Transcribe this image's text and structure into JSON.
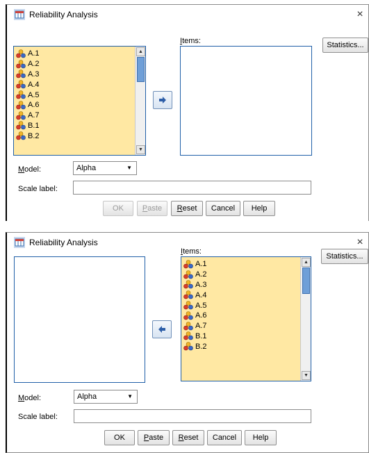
{
  "dialogs": [
    {
      "title": "Reliability Analysis",
      "close_glyph": "×",
      "items_label": "Items:",
      "statistics_label": "Statistics...",
      "model_label": "Model:",
      "model_value": "Alpha",
      "scale_label": "Scale label:",
      "scale_value": "",
      "left_list": [
        "A.1",
        "A.2",
        "A.3",
        "A.4",
        "A.5",
        "A.6",
        "A.7",
        "B.1",
        "B.2"
      ],
      "right_list": [],
      "move_direction": "right",
      "buttons": {
        "ok": "OK",
        "paste": "Paste",
        "reset": "Reset",
        "cancel": "Cancel",
        "help": "Help"
      },
      "ok_enabled": false,
      "paste_enabled": false
    },
    {
      "title": "Reliability Analysis",
      "close_glyph": "×",
      "items_label": "Items:",
      "statistics_label": "Statistics...",
      "model_label": "Model:",
      "model_value": "Alpha",
      "scale_label": "Scale label:",
      "scale_value": "",
      "left_list": [],
      "right_list": [
        "A.1",
        "A.2",
        "A.3",
        "A.4",
        "A.5",
        "A.6",
        "A.7",
        "B.1",
        "B.2"
      ],
      "move_direction": "left",
      "buttons": {
        "ok": "OK",
        "paste": "Paste",
        "reset": "Reset",
        "cancel": "Cancel",
        "help": "Help"
      },
      "ok_enabled": true,
      "paste_enabled": true
    }
  ],
  "icons": {
    "app": "spss-app-icon",
    "variable": "scale-variable-icon",
    "move_right": "arrow-right-icon",
    "move_left": "arrow-left-icon",
    "dropdown": "chevron-down-icon"
  },
  "colors": {
    "selected_list_bg": "#ffe8a3",
    "list_border": "#1f5fa8",
    "scroll_thumb": "#6f9fd8"
  }
}
